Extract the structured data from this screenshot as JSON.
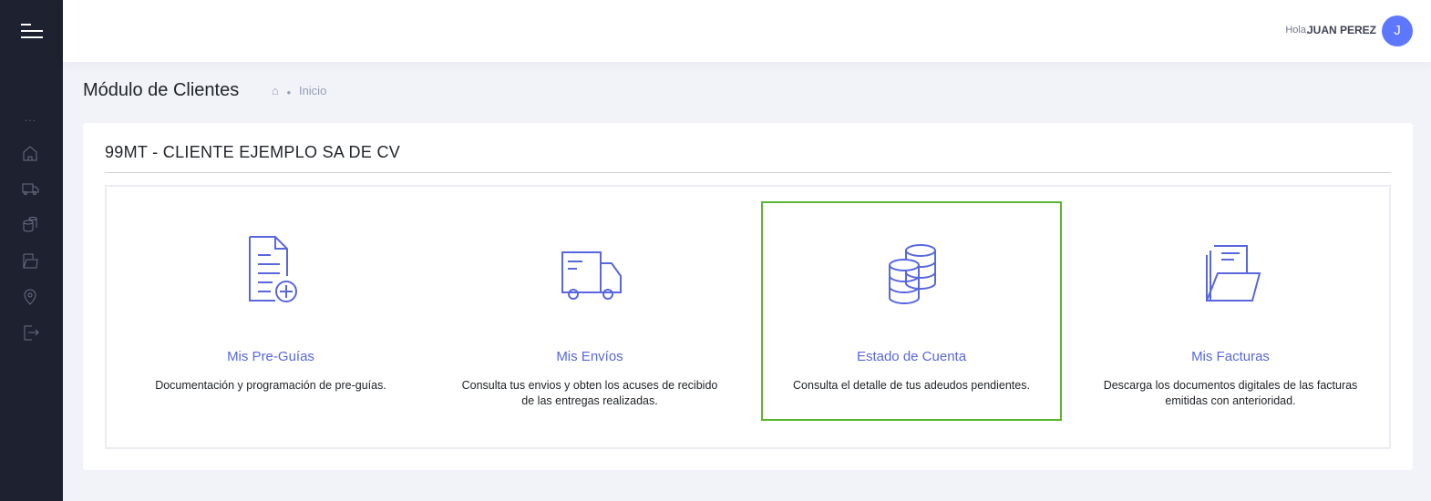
{
  "header": {
    "greeting": "Hola,",
    "user": "JUAN PEREZ",
    "avatar_initial": "J"
  },
  "page": {
    "title": "Módulo de Clientes",
    "breadcrumb": "Inicio"
  },
  "card": {
    "title": "99MT - CLIENTE EJEMPLO SA DE CV"
  },
  "sidebar": {
    "section_dots": "...",
    "items": [
      "home-icon",
      "truck-icon",
      "coins-icon",
      "folder-icon",
      "location-icon",
      "logout-icon"
    ]
  },
  "tiles": [
    {
      "name": "Mis Pre-Guías",
      "desc": "Documentación y programación de pre-guías."
    },
    {
      "name": "Mis Envíos",
      "desc": "Consulta tus envios y obten los acuses de recibido de las entregas realizadas."
    },
    {
      "name": "Estado de Cuenta",
      "desc": "Consulta el detalle de tus adeudos pendientes."
    },
    {
      "name": "Mis Facturas",
      "desc": "Descarga los documentos digitales de las facturas emitidas con anterioridad."
    }
  ],
  "colors": {
    "accent": "#5867dd",
    "active_border": "#5cb531",
    "sidebar": "#1e2130"
  }
}
